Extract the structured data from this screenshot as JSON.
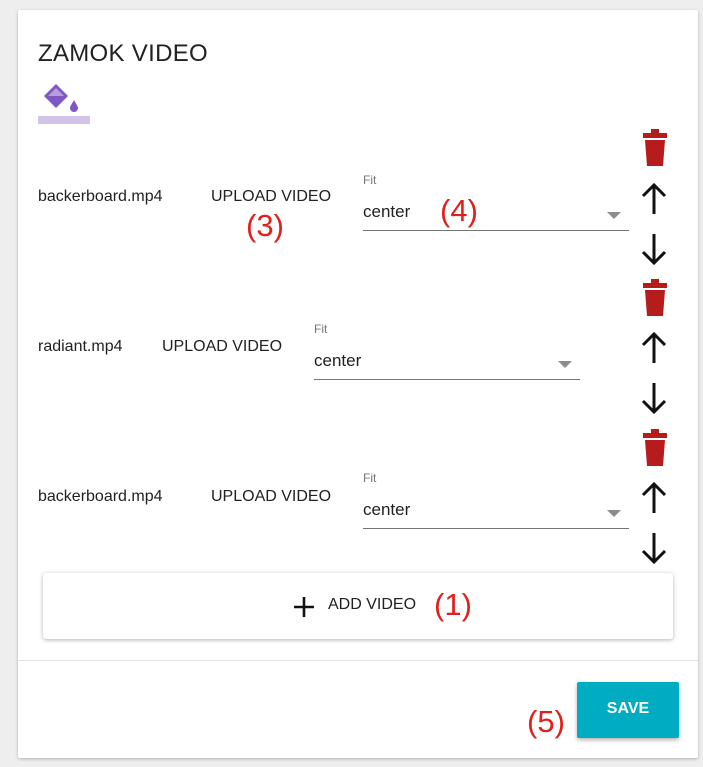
{
  "widget": {
    "title": "ZAMOK VIDEO",
    "icon": "format-color-fill-icon",
    "icon_color": "#7e57c2",
    "icon_underline_color": "#d1c4e9"
  },
  "videos": [
    {
      "filename": "backerboard.mp4",
      "upload_label": "UPLOAD VIDEO",
      "fit_label": "Fit",
      "fit_value": "center"
    },
    {
      "filename": "radiant.mp4",
      "upload_label": "UPLOAD VIDEO",
      "fit_label": "Fit",
      "fit_value": "center"
    },
    {
      "filename": "backerboard.mp4",
      "upload_label": "UPLOAD VIDEO",
      "fit_label": "Fit",
      "fit_value": "center"
    }
  ],
  "row_icons": {
    "delete_icon": "trash-icon",
    "delete_color": "#b71c1c",
    "up_icon": "arrow-up-icon",
    "down_icon": "arrow-down-icon"
  },
  "add_button": {
    "label": "ADD VIDEO",
    "icon": "plus-icon"
  },
  "save_button": {
    "label": "SAVE",
    "color": "#00acc1"
  },
  "annotations": {
    "add": "(1)",
    "upload": "(3)",
    "fit": "(4)",
    "save": "(5)",
    "color": "#e0201d"
  }
}
